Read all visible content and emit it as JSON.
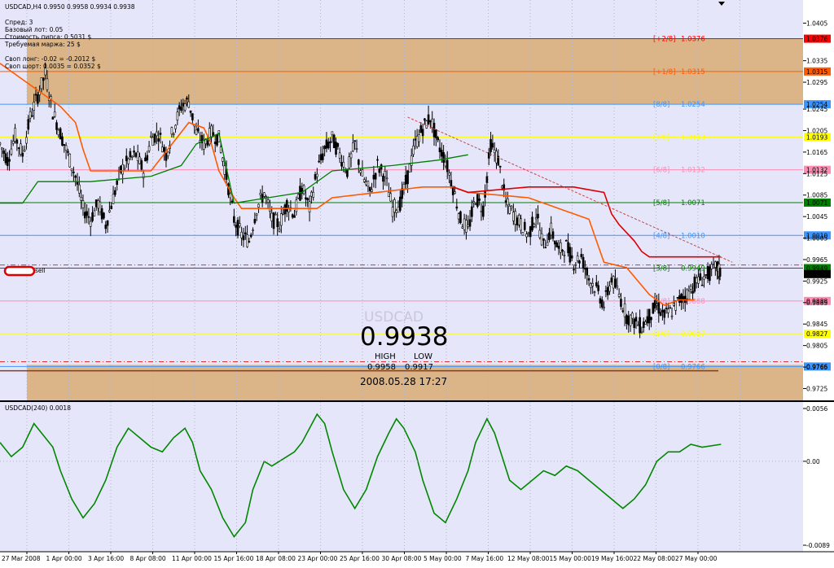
{
  "header": {
    "symbol_line": "USDCAD,H4  0.9950 0.9958 0.9934 0.9938",
    "info_lines": [
      "Спред: 3",
      "Базовый лот: 0.05",
      "Стоимость пипса: 0.5031 $",
      "Требуемая маржа: 25 $",
      "",
      "Своп лонг: -0.02 = -0.2012 $",
      "Своп шорт: 0.0035 = 0.0352 $"
    ]
  },
  "colors": {
    "plot_bg": "#e6e6fa",
    "zone_fill": "#dbb487",
    "candle": "#000000",
    "ma_orange": "#ff5a00",
    "ma_red": "#dd0000",
    "ma_green": "#008000",
    "oscillator": "#008800",
    "trendline": "#c84646"
  },
  "overlay": {
    "symbol": "USDCAD",
    "price": "0.9938",
    "high_label": "HIGH",
    "low_label": "LOW",
    "high": "0.9958",
    "low": "0.9917",
    "datetime": "2008.05.28 17:27",
    "sell_label": "sell"
  },
  "murrey_levels": [
    {
      "label": "[+2/8]",
      "price": "1.0376",
      "value": 1.0376,
      "color": "#ff0000",
      "badge_bg": "#ff0000",
      "badge_fg": "#ffffff"
    },
    {
      "label": "[+1/8]",
      "price": "1.0315",
      "value": 1.0315,
      "color": "#ff5a00",
      "badge_bg": "#ff5a00",
      "badge_fg": "#ffffff"
    },
    {
      "label": "[8/8]",
      "price": "1.0254",
      "value": 1.0254,
      "color": "#3c96ff",
      "badge_bg": "#3c96ff",
      "badge_fg": "#ffffff"
    },
    {
      "label": "[7/8]",
      "price": "1.0193",
      "value": 1.0193,
      "color": "#ffff00",
      "badge_bg": "#ffff00",
      "badge_fg": "#000000"
    },
    {
      "label": "[6/8]",
      "price": "1.0132",
      "value": 1.0132,
      "color": "#ff8cb4",
      "badge_bg": "#ff8cb4",
      "badge_fg": "#ffffff"
    },
    {
      "label": "[5/8]",
      "price": "1.0071",
      "value": 1.0071,
      "color": "#008000",
      "badge_bg": "#008000",
      "badge_fg": "#ffffff"
    },
    {
      "label": "[4/8]",
      "price": "1.0010",
      "value": 1.001,
      "color": "#3c96ff",
      "badge_bg": "#3c96ff",
      "badge_fg": "#ffffff"
    },
    {
      "label": "[3/8]",
      "price": "0.9949",
      "value": 0.9949,
      "color": "#008000",
      "badge_bg": "#008000",
      "badge_fg": "#ffffff"
    },
    {
      "label": "[2/8]",
      "price": "0.9888",
      "value": 0.9888,
      "color": "#ff8cb4",
      "badge_bg": "#ff8cb4",
      "badge_fg": "#ffffff"
    },
    {
      "label": "[1/8]",
      "price": "0.9827",
      "value": 0.9827,
      "color": "#ffff00",
      "badge_bg": "#ffff00",
      "badge_fg": "#000000"
    },
    {
      "label": "[0/8]",
      "price": "0.9766",
      "value": 0.9766,
      "color": "#3c96ff",
      "badge_bg": "#3c96ff",
      "badge_fg": "#ffffff"
    }
  ],
  "chart_data": [
    {
      "type": "candlestick",
      "title": "USDCAD,H4",
      "ylim": [
        0.9703,
        1.0448
      ],
      "yticks": [
        "1.0405",
        "1.0335",
        "1.0295",
        "1.0245",
        "1.0205",
        "1.0165",
        "1.0125",
        "1.0085",
        "1.0045",
        "1.0005",
        "0.9965",
        "0.9925",
        "0.9885",
        "0.9845",
        "0.9805",
        "0.9765",
        "0.9725"
      ],
      "ytick_values": [
        1.0405,
        1.0335,
        1.0295,
        1.0245,
        1.0205,
        1.0165,
        1.0125,
        1.0085,
        1.0045,
        1.0005,
        0.9965,
        0.9925,
        0.9885,
        0.9845,
        0.9805,
        0.9765,
        0.9725
      ],
      "current_price_badges": [
        {
          "text": "0.9949",
          "value": 0.9949,
          "bg": "#008000",
          "fg": "#ffffff"
        },
        {
          "text": "0.9938",
          "value": 0.9938,
          "bg": "#000000",
          "fg": "#ffffff"
        }
      ],
      "x_labels": [
        "27 Mar 2008",
        "1 Apr 00:00",
        "3 Apr 16:00",
        "8 Apr 08:00",
        "11 Apr 00:00",
        "15 Apr 16:00",
        "18 Apr 08:00",
        "23 Apr 00:00",
        "25 Apr 16:00",
        "30 Apr 08:00",
        "5 May 00:00",
        "7 May 16:00",
        "12 May 08:00",
        "15 May 00:00",
        "19 May 16:00",
        "22 May 08:00",
        "27 May 00:00"
      ],
      "x_label_positions": [
        0.0,
        0.0556,
        0.1111,
        0.1667,
        0.2222,
        0.2778,
        0.3333,
        0.3889,
        0.4444,
        0.5,
        0.5556,
        0.6111,
        0.6667,
        0.7222,
        0.7778,
        0.8333,
        0.8889
      ],
      "price_path": [
        [
          0.0,
          1.018
        ],
        [
          0.01,
          1.015
        ],
        [
          0.02,
          1.0195
        ],
        [
          0.03,
          1.016
        ],
        [
          0.04,
          1.023
        ],
        [
          0.05,
          1.027
        ],
        [
          0.06,
          1.031
        ],
        [
          0.07,
          1.024
        ],
        [
          0.08,
          1.02
        ],
        [
          0.09,
          1.016
        ],
        [
          0.1,
          1.012
        ],
        [
          0.11,
          1.006
        ],
        [
          0.12,
          1.004
        ],
        [
          0.13,
          1.007
        ],
        [
          0.14,
          1.003
        ],
        [
          0.15,
          1.008
        ],
        [
          0.16,
          1.013
        ],
        [
          0.17,
          1.015
        ],
        [
          0.18,
          1.016
        ],
        [
          0.19,
          1.013
        ],
        [
          0.2,
          1.019
        ],
        [
          0.21,
          1.02
        ],
        [
          0.22,
          1.016
        ],
        [
          0.23,
          1.021
        ],
        [
          0.24,
          1.025
        ],
        [
          0.25,
          1.026
        ],
        [
          0.26,
          1.02
        ],
        [
          0.27,
          1.018
        ],
        [
          0.28,
          1.02
        ],
        [
          0.29,
          1.019
        ],
        [
          0.3,
          1.012
        ],
        [
          0.31,
          1.004
        ],
        [
          0.32,
          1.001
        ],
        [
          0.33,
          1.0
        ],
        [
          0.34,
          1.006
        ],
        [
          0.35,
          1.009
        ],
        [
          0.36,
          1.004
        ],
        [
          0.37,
          1.003
        ],
        [
          0.38,
          1.007
        ],
        [
          0.39,
          1.005
        ],
        [
          0.4,
          1.01
        ],
        [
          0.41,
          1.006
        ],
        [
          0.42,
          1.013
        ],
        [
          0.43,
          1.017
        ],
        [
          0.44,
          1.019
        ],
        [
          0.45,
          1.016
        ],
        [
          0.46,
          1.013
        ],
        [
          0.47,
          1.018
        ],
        [
          0.48,
          1.012
        ],
        [
          0.49,
          1.009
        ],
        [
          0.5,
          1.014
        ],
        [
          0.51,
          1.012
        ],
        [
          0.52,
          1.006
        ],
        [
          0.53,
          1.007
        ],
        [
          0.54,
          1.012
        ],
        [
          0.55,
          1.018
        ],
        [
          0.56,
          1.021
        ],
        [
          0.57,
          1.023
        ],
        [
          0.58,
          1.018
        ],
        [
          0.59,
          1.015
        ],
        [
          0.6,
          1.01
        ],
        [
          0.61,
          1.004
        ],
        [
          0.62,
          1.002
        ],
        [
          0.63,
          1.008
        ],
        [
          0.64,
          1.006
        ],
        [
          0.65,
          1.018
        ],
        [
          0.66,
          1.015
        ],
        [
          0.67,
          1.007
        ],
        [
          0.68,
          1.005
        ],
        [
          0.69,
          1.003
        ],
        [
          0.7,
          1.001
        ],
        [
          0.71,
          1.005
        ],
        [
          0.72,
          0.999
        ],
        [
          0.73,
          1.002
        ],
        [
          0.74,
          0.998
        ],
        [
          0.75,
          0.999
        ],
        [
          0.76,
          0.996
        ],
        [
          0.77,
          0.997
        ],
        [
          0.78,
          0.993
        ],
        [
          0.79,
          0.991
        ],
        [
          0.8,
          0.988
        ],
        [
          0.81,
          0.993
        ],
        [
          0.82,
          0.99
        ],
        [
          0.83,
          0.986
        ],
        [
          0.84,
          0.985
        ],
        [
          0.85,
          0.984
        ],
        [
          0.86,
          0.986
        ],
        [
          0.87,
          0.988
        ],
        [
          0.88,
          0.986
        ],
        [
          0.89,
          0.987
        ],
        [
          0.9,
          0.989
        ],
        [
          0.91,
          0.99
        ],
        [
          0.92,
          0.992
        ],
        [
          0.93,
          0.993
        ],
        [
          0.94,
          0.994
        ],
        [
          0.95,
          0.995
        ],
        [
          0.955,
          0.9938
        ]
      ],
      "ma_orange": [
        [
          0.0,
          1.033
        ],
        [
          0.08,
          1.025
        ],
        [
          0.1,
          1.022
        ],
        [
          0.11,
          1.017
        ],
        [
          0.12,
          1.013
        ],
        [
          0.2,
          1.013
        ],
        [
          0.25,
          1.022
        ],
        [
          0.27,
          1.021
        ],
        [
          0.28,
          1.018
        ],
        [
          0.29,
          1.013
        ],
        [
          0.31,
          1.008
        ],
        [
          0.32,
          1.006
        ],
        [
          0.42,
          1.006
        ],
        [
          0.44,
          1.008
        ],
        [
          0.5,
          1.009
        ],
        [
          0.56,
          1.01
        ],
        [
          0.6,
          1.01
        ],
        [
          0.62,
          1.009
        ],
        [
          0.7,
          1.008
        ],
        [
          0.74,
          1.006
        ],
        [
          0.78,
          1.004
        ],
        [
          0.79,
          1.0
        ],
        [
          0.8,
          0.996
        ],
        [
          0.83,
          0.995
        ],
        [
          0.86,
          0.99
        ],
        [
          0.88,
          0.988
        ],
        [
          0.9,
          0.989
        ],
        [
          0.92,
          0.989
        ]
      ],
      "ma_red": [
        [
          0.6,
          1.01
        ],
        [
          0.62,
          1.009
        ],
        [
          0.7,
          1.01
        ],
        [
          0.76,
          1.01
        ],
        [
          0.8,
          1.009
        ],
        [
          0.81,
          1.005
        ],
        [
          0.82,
          1.003
        ],
        [
          0.84,
          1.0
        ],
        [
          0.85,
          0.998
        ],
        [
          0.86,
          0.997
        ],
        [
          0.955,
          0.997
        ]
      ],
      "ma_green": [
        [
          0.0,
          1.007
        ],
        [
          0.03,
          1.007
        ],
        [
          0.05,
          1.011
        ],
        [
          0.12,
          1.011
        ],
        [
          0.2,
          1.012
        ],
        [
          0.24,
          1.014
        ],
        [
          0.26,
          1.018
        ],
        [
          0.29,
          1.02
        ],
        [
          0.31,
          1.007
        ],
        [
          0.4,
          1.009
        ],
        [
          0.44,
          1.013
        ],
        [
          0.52,
          1.014
        ],
        [
          0.58,
          1.015
        ],
        [
          0.62,
          1.016
        ]
      ],
      "trendline": [
        [
          0.54,
          1.023
        ],
        [
          0.97,
          0.996
        ]
      ],
      "vlines": [
        0.0,
        0.0556,
        0.1111,
        0.1667,
        0.2222,
        0.2778,
        0.3333,
        0.3889,
        0.4444,
        0.5,
        0.5556,
        0.6111,
        0.6667,
        0.7222,
        0.7778,
        0.8333,
        0.8889,
        0.9444
      ]
    },
    {
      "type": "line",
      "title": "USDCAD(240)  0.0018",
      "ylim": [
        -0.0089,
        0.0056
      ],
      "yticks": [
        "0.0056",
        "0.00",
        "-0.0089"
      ],
      "ytick_values": [
        0.0056,
        0.0,
        -0.0089
      ],
      "series": [
        {
          "values": [
            [
              0.0,
              0.002
            ],
            [
              0.015,
              0.0005
            ],
            [
              0.03,
              0.0015
            ],
            [
              0.045,
              0.004
            ],
            [
              0.055,
              0.003
            ],
            [
              0.07,
              0.0015
            ],
            [
              0.08,
              -0.001
            ],
            [
              0.095,
              -0.004
            ],
            [
              0.11,
              -0.006
            ],
            [
              0.125,
              -0.0045
            ],
            [
              0.14,
              -0.002
            ],
            [
              0.155,
              0.0015
            ],
            [
              0.17,
              0.0035
            ],
            [
              0.185,
              0.0025
            ],
            [
              0.2,
              0.0015
            ],
            [
              0.215,
              0.001
            ],
            [
              0.23,
              0.0025
            ],
            [
              0.245,
              0.0035
            ],
            [
              0.255,
              0.002
            ],
            [
              0.265,
              -0.001
            ],
            [
              0.28,
              -0.003
            ],
            [
              0.295,
              -0.006
            ],
            [
              0.31,
              -0.008
            ],
            [
              0.325,
              -0.0065
            ],
            [
              0.335,
              -0.003
            ],
            [
              0.35,
              0.0
            ],
            [
              0.36,
              -0.0005
            ],
            [
              0.37,
              0.0
            ],
            [
              0.38,
              0.0005
            ],
            [
              0.39,
              0.001
            ],
            [
              0.4,
              0.002
            ],
            [
              0.41,
              0.0035
            ],
            [
              0.42,
              0.005
            ],
            [
              0.43,
              0.004
            ],
            [
              0.44,
              0.001
            ],
            [
              0.455,
              -0.003
            ],
            [
              0.47,
              -0.005
            ],
            [
              0.485,
              -0.003
            ],
            [
              0.5,
              0.0005
            ],
            [
              0.515,
              0.003
            ],
            [
              0.525,
              0.0045
            ],
            [
              0.535,
              0.0035
            ],
            [
              0.55,
              0.001
            ],
            [
              0.56,
              -0.002
            ],
            [
              0.575,
              -0.0055
            ],
            [
              0.59,
              -0.0065
            ],
            [
              0.605,
              -0.004
            ],
            [
              0.62,
              -0.001
            ],
            [
              0.63,
              0.002
            ],
            [
              0.645,
              0.0045
            ],
            [
              0.655,
              0.003
            ],
            [
              0.665,
              0.0005
            ],
            [
              0.675,
              -0.002
            ],
            [
              0.69,
              -0.003
            ],
            [
              0.705,
              -0.002
            ],
            [
              0.72,
              -0.001
            ],
            [
              0.735,
              -0.0015
            ],
            [
              0.75,
              -0.0005
            ],
            [
              0.765,
              -0.001
            ],
            [
              0.78,
              -0.002
            ],
            [
              0.795,
              -0.003
            ],
            [
              0.81,
              -0.004
            ],
            [
              0.825,
              -0.005
            ],
            [
              0.84,
              -0.004
            ],
            [
              0.855,
              -0.0025
            ],
            [
              0.87,
              0.0
            ],
            [
              0.885,
              0.001
            ],
            [
              0.9,
              0.001
            ],
            [
              0.915,
              0.0018
            ],
            [
              0.93,
              0.0015
            ],
            [
              0.955,
              0.0018
            ]
          ]
        }
      ],
      "x_labels": [
        "27 Mar 2008",
        "1 Apr 00:00",
        "3 Apr 16:00",
        "8 Apr 08:00",
        "11 Apr 00:00",
        "15 Apr 16:00",
        "18 Apr 08:00",
        "23 Apr 00:00",
        "25 Apr 16:00",
        "30 Apr 08:00",
        "5 May 00:00",
        "7 May 16:00",
        "12 May 08:00",
        "15 May 00:00",
        "19 May 16:00",
        "22 May 08:00",
        "27 May 00:00"
      ]
    }
  ]
}
